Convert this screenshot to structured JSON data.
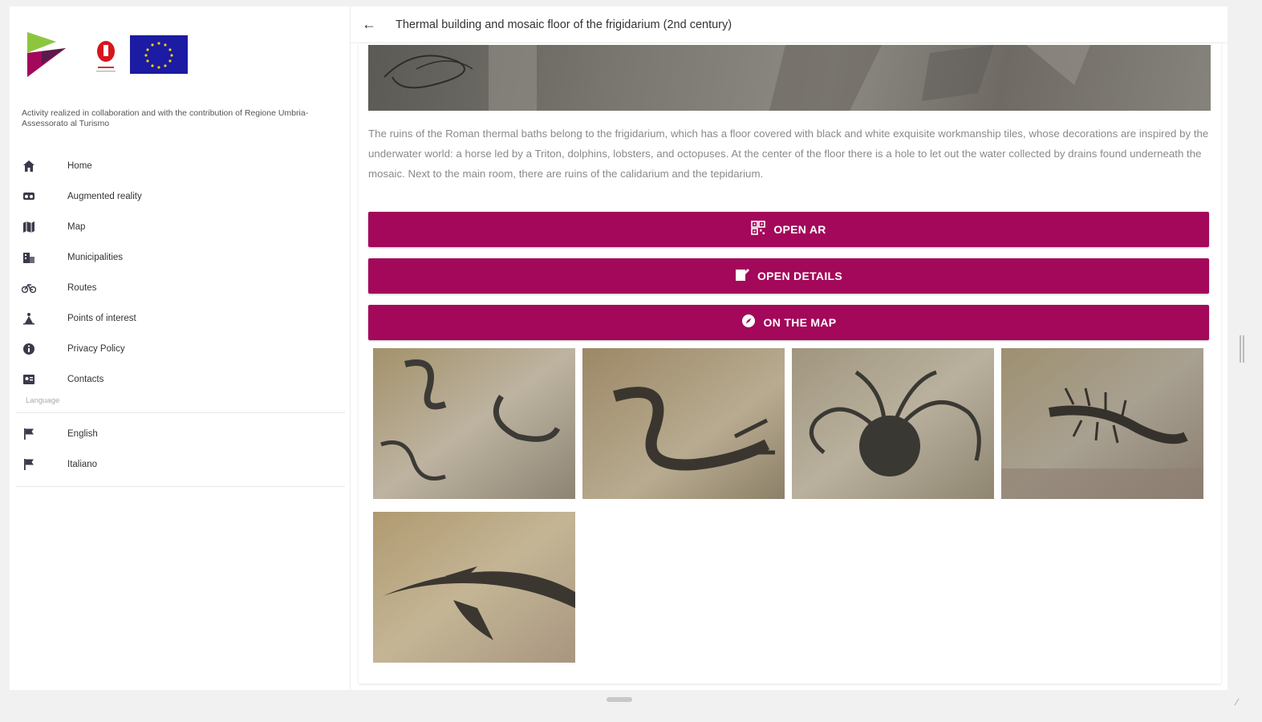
{
  "sidebar": {
    "credit_text": "Activity realized in collaboration and with the contribution of Regione Umbria-Assessorato al Turismo",
    "nav_items": [
      {
        "label": "Home",
        "icon": "home-icon"
      },
      {
        "label": "Augmented reality",
        "icon": "vr-headset-icon"
      },
      {
        "label": "Map",
        "icon": "map-icon"
      },
      {
        "label": "Municipalities",
        "icon": "building-icon"
      },
      {
        "label": "Routes",
        "icon": "bicycle-icon"
      },
      {
        "label": "Points of interest",
        "icon": "landmark-icon"
      },
      {
        "label": "Privacy Policy",
        "icon": "info-icon"
      },
      {
        "label": "Contacts",
        "icon": "contact-card-icon"
      }
    ],
    "language_caption": "Language",
    "languages": [
      {
        "label": "English",
        "icon": "flag-icon"
      },
      {
        "label": "Italiano",
        "icon": "flag-icon"
      }
    ]
  },
  "header": {
    "title": "Thermal building and mosaic floor of the frigidarium (2nd century)"
  },
  "main": {
    "description": "The ruins of the Roman thermal baths belong to the frigidarium, which has a floor covered with black and white exquisite workmanship tiles, whose decorations are inspired by the underwater world: a horse led by a Triton, dolphins, lobsters, and octopuses. At the center of the floor there is a hole to let out the water collected by drains found underneath the mosaic. Next to the main room, there are ruins of the calidarium and the tepidarium.",
    "buttons": {
      "open_ar": "OPEN AR",
      "open_details": "OPEN DETAILS",
      "on_the_map": "ON THE MAP"
    },
    "gallery_count": 5
  },
  "colors": {
    "accent": "#a3085a",
    "eu_blue": "#1b1ba3"
  }
}
